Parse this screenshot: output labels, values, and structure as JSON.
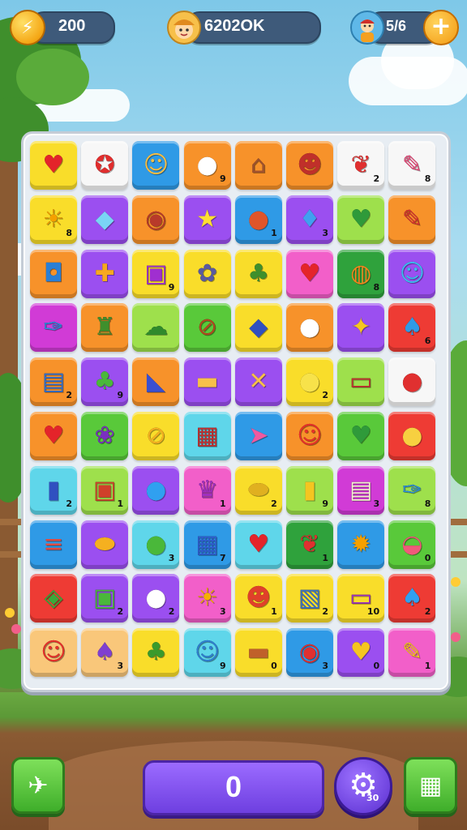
{
  "hud": {
    "coins": "200",
    "coin_icon": "lightning-bolt-icon",
    "score": "6202OK",
    "lives": "5/6",
    "add_button": "+"
  },
  "colors": {
    "yellow": "#f9dd2a",
    "white": "#f7f7f7",
    "blue": "#2f9ae6",
    "orange": "#f7922a",
    "purple": "#9b4ff0",
    "green": "#59c93a",
    "lime": "#9ee04c",
    "red": "#ee3b34",
    "pink": "#f25fc9",
    "cyan": "#5fd6ea",
    "peach": "#f9c77a",
    "darkgreen": "#2fa23c",
    "magenta": "#d13bd6"
  },
  "board": {
    "rows": [
      [
        {
          "c": "yellow",
          "g": "♥",
          "gc": "#e4242a",
          "n": ""
        },
        {
          "c": "white",
          "g": "✪",
          "gc": "#e02d2d",
          "n": ""
        },
        {
          "c": "blue",
          "g": "☺",
          "gc": "#f7c04a",
          "n": ""
        },
        {
          "c": "orange",
          "g": "●",
          "gc": "#ffffff",
          "n": "9"
        },
        {
          "c": "orange",
          "g": "⌂",
          "gc": "#a0522d",
          "n": ""
        },
        {
          "c": "orange",
          "g": "☻",
          "gc": "#c0302a",
          "n": ""
        },
        {
          "c": "white",
          "g": "❦",
          "gc": "#e03030",
          "n": "2"
        },
        {
          "c": "white",
          "g": "✎",
          "gc": "#e84a7a",
          "n": "8"
        }
      ],
      [
        {
          "c": "yellow",
          "g": "☀",
          "gc": "#f5a000",
          "n": "8"
        },
        {
          "c": "purple",
          "g": "◆",
          "gc": "#7ad4f5",
          "n": ""
        },
        {
          "c": "orange",
          "g": "◉",
          "gc": "#b83a2a",
          "n": ""
        },
        {
          "c": "purple",
          "g": "★",
          "gc": "#ffe033",
          "n": ""
        },
        {
          "c": "blue",
          "g": "●",
          "gc": "#e0552a",
          "n": "1"
        },
        {
          "c": "purple",
          "g": "♦",
          "gc": "#40a0f0",
          "n": "3"
        },
        {
          "c": "lime",
          "g": "♥",
          "gc": "#2f9a3a",
          "n": ""
        },
        {
          "c": "orange",
          "g": "✎",
          "gc": "#d83030",
          "n": ""
        }
      ],
      [
        {
          "c": "orange",
          "g": "◘",
          "gc": "#2a7fd6",
          "n": ""
        },
        {
          "c": "purple",
          "g": "✚",
          "gc": "#f7a820",
          "n": ""
        },
        {
          "c": "yellow",
          "g": "▣",
          "gc": "#a02fd0",
          "n": "9"
        },
        {
          "c": "yellow",
          "g": "✿",
          "gc": "#5a5aa0",
          "n": ""
        },
        {
          "c": "yellow",
          "g": "♣",
          "gc": "#3f8f2c",
          "n": ""
        },
        {
          "c": "pink",
          "g": "♥",
          "gc": "#e4242a",
          "n": ""
        },
        {
          "c": "darkgreen",
          "g": "◍",
          "gc": "#f08a20",
          "n": "8"
        },
        {
          "c": "purple",
          "g": "☺",
          "gc": "#40b8f0",
          "n": ""
        }
      ],
      [
        {
          "c": "magenta",
          "g": "✑",
          "gc": "#2a8fe0",
          "n": ""
        },
        {
          "c": "orange",
          "g": "♜",
          "gc": "#3f8f2c",
          "n": ""
        },
        {
          "c": "lime",
          "g": "☁",
          "gc": "#2f8a2c",
          "n": ""
        },
        {
          "c": "green",
          "g": "⊘",
          "gc": "#b04a20",
          "n": ""
        },
        {
          "c": "yellow",
          "g": "◆",
          "gc": "#3050c0",
          "n": ""
        },
        {
          "c": "orange",
          "g": "●",
          "gc": "#ffffff",
          "n": ""
        },
        {
          "c": "purple",
          "g": "✦",
          "gc": "#f5c520",
          "n": ""
        },
        {
          "c": "red",
          "g": "♠",
          "gc": "#2f9ae6",
          "n": "6"
        }
      ],
      [
        {
          "c": "orange",
          "g": "▤",
          "gc": "#2f6fd0",
          "n": "2"
        },
        {
          "c": "purple",
          "g": "♣",
          "gc": "#4ab83a",
          "n": "9"
        },
        {
          "c": "orange",
          "g": "◣",
          "gc": "#3a4fd0",
          "n": ""
        },
        {
          "c": "purple",
          "g": "▬",
          "gc": "#f7c04a",
          "n": ""
        },
        {
          "c": "purple",
          "g": "✕",
          "gc": "#f7c04a",
          "n": ""
        },
        {
          "c": "yellow",
          "g": "●",
          "gc": "#f7e24a",
          "n": "2"
        },
        {
          "c": "lime",
          "g": "▭",
          "gc": "#c03030",
          "n": ""
        },
        {
          "c": "white",
          "g": "●",
          "gc": "#e03030",
          "n": ""
        }
      ],
      [
        {
          "c": "orange",
          "g": "♥",
          "gc": "#e4242a",
          "n": ""
        },
        {
          "c": "green",
          "g": "❀",
          "gc": "#7a30c0",
          "n": ""
        },
        {
          "c": "yellow",
          "g": "⊘",
          "gc": "#f5b020",
          "n": ""
        },
        {
          "c": "cyan",
          "g": "▦",
          "gc": "#c03030",
          "n": ""
        },
        {
          "c": "blue",
          "g": "➤",
          "gc": "#f05aa0",
          "n": ""
        },
        {
          "c": "orange",
          "g": "☺",
          "gc": "#e8302a",
          "n": ""
        },
        {
          "c": "green",
          "g": "♥",
          "gc": "#2f9a3a",
          "n": ""
        },
        {
          "c": "red",
          "g": "●",
          "gc": "#f7d040",
          "n": ""
        }
      ],
      [
        {
          "c": "cyan",
          "g": "▮",
          "gc": "#3050c0",
          "n": "2"
        },
        {
          "c": "lime",
          "g": "▣",
          "gc": "#d0402a",
          "n": "1"
        },
        {
          "c": "purple",
          "g": "●",
          "gc": "#30a0f0",
          "n": ""
        },
        {
          "c": "pink",
          "g": "♛",
          "gc": "#a030c0",
          "n": "1"
        },
        {
          "c": "yellow",
          "g": "⬬",
          "gc": "#e0b020",
          "n": "2"
        },
        {
          "c": "lime",
          "g": "▮",
          "gc": "#f5c520",
          "n": "9"
        },
        {
          "c": "magenta",
          "g": "▤",
          "gc": "#f5f0d0",
          "n": "3"
        },
        {
          "c": "lime",
          "g": "✑",
          "gc": "#2a8fe0",
          "n": "8"
        }
      ],
      [
        {
          "c": "blue",
          "g": "≡",
          "gc": "#e04a40",
          "n": ""
        },
        {
          "c": "purple",
          "g": "⬬",
          "gc": "#f5b020",
          "n": ""
        },
        {
          "c": "cyan",
          "g": "●",
          "gc": "#4ab83a",
          "n": "3"
        },
        {
          "c": "blue",
          "g": "▦",
          "gc": "#2f5fd0",
          "n": "7"
        },
        {
          "c": "cyan",
          "g": "♥",
          "gc": "#e4242a",
          "n": ""
        },
        {
          "c": "darkgreen",
          "g": "❦",
          "gc": "#e03030",
          "n": "1"
        },
        {
          "c": "blue",
          "g": "✹",
          "gc": "#f5a000",
          "n": ""
        },
        {
          "c": "green",
          "g": "◒",
          "gc": "#f05a7a",
          "n": "0"
        }
      ],
      [
        {
          "c": "red",
          "g": "◈",
          "gc": "#3aa83a",
          "n": ""
        },
        {
          "c": "purple",
          "g": "▣",
          "gc": "#4ab83a",
          "n": "2"
        },
        {
          "c": "purple",
          "g": "●",
          "gc": "#ffffff",
          "n": "2"
        },
        {
          "c": "pink",
          "g": "☀",
          "gc": "#f5b000",
          "n": "3"
        },
        {
          "c": "yellow",
          "g": "☻",
          "gc": "#e0402a",
          "n": "1"
        },
        {
          "c": "yellow",
          "g": "▧",
          "gc": "#3a70c0",
          "n": "2"
        },
        {
          "c": "yellow",
          "g": "▭",
          "gc": "#9a30c0",
          "n": "10"
        },
        {
          "c": "red",
          "g": "♠",
          "gc": "#30a0f0",
          "n": "2"
        }
      ],
      [
        {
          "c": "peach",
          "g": "☺",
          "gc": "#e8302a",
          "n": ""
        },
        {
          "c": "peach",
          "g": "♠",
          "gc": "#8040d0",
          "n": "3"
        },
        {
          "c": "yellow",
          "g": "♣",
          "gc": "#3a9a2c",
          "n": ""
        },
        {
          "c": "cyan",
          "g": "☺",
          "gc": "#2f80d0",
          "n": "9"
        },
        {
          "c": "yellow",
          "g": "▬",
          "gc": "#c0602a",
          "n": "0"
        },
        {
          "c": "blue",
          "g": "◉",
          "gc": "#e03030",
          "n": "3"
        },
        {
          "c": "purple",
          "g": "♥",
          "gc": "#f5c520",
          "n": "0"
        },
        {
          "c": "pink",
          "g": "✎",
          "gc": "#f5c520",
          "n": "1"
        }
      ]
    ]
  },
  "controls": {
    "left_icon": "paper-plane-icon",
    "left_glyph": "✈",
    "score_value": "0",
    "settings_icon": "gear-icon",
    "settings_glyph": "⚙",
    "settings_badge": "30",
    "right_icon": "grid-calendar-icon",
    "right_glyph": "▦"
  }
}
